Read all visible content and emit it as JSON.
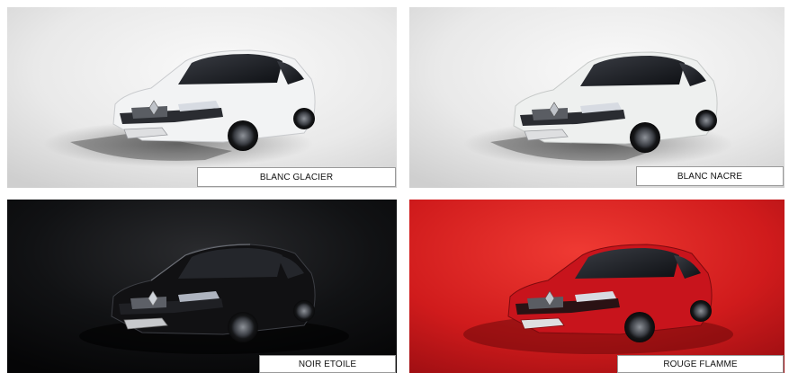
{
  "swatches": [
    {
      "caption": "BLANC GLACIER",
      "body_color": "#f2f3f4",
      "background": "#e6e6e6"
    },
    {
      "caption": "BLANC NACRE",
      "body_color": "#eef0ef",
      "background": "#e9e9e9"
    },
    {
      "caption": "NOIR ETOILE",
      "body_color": "#111113",
      "background": "#0c0c0e"
    },
    {
      "caption": "ROUGE FLAMME",
      "body_color": "#c8141c",
      "background": "#d41f1f"
    }
  ]
}
